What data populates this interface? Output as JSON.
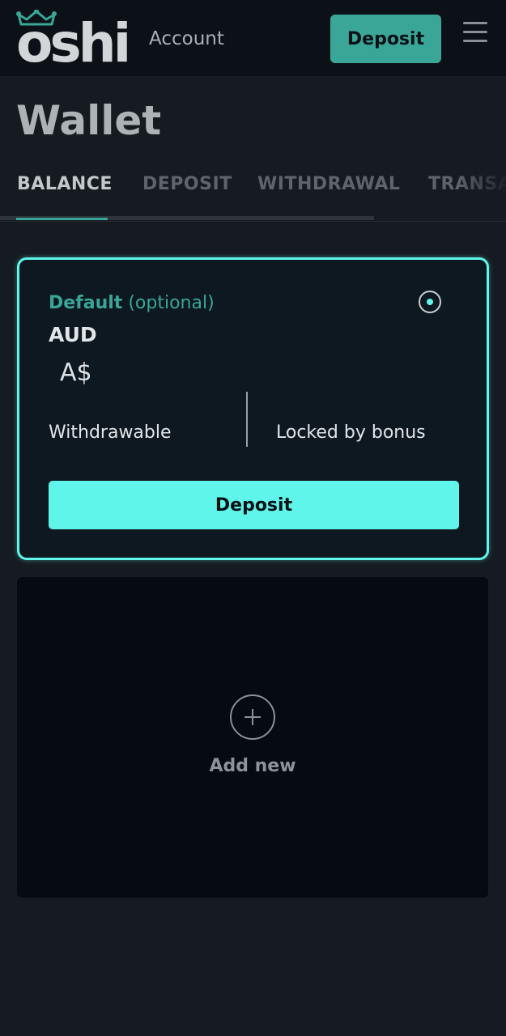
{
  "header": {
    "logo_text": "oshi",
    "account_label": "Account",
    "deposit_button": "Deposit"
  },
  "page": {
    "title": "Wallet"
  },
  "tabs": [
    {
      "label": "BALANCE",
      "active": true
    },
    {
      "label": "DEPOSIT",
      "active": false
    },
    {
      "label": "WITHDRAWAL",
      "active": false
    },
    {
      "label": "TRANSACTIONS",
      "active": false
    }
  ],
  "wallet": {
    "default_label": "Default",
    "optional_label": "(optional)",
    "currency": "AUD",
    "symbol": "A$",
    "withdrawable_label": "Withdrawable",
    "locked_label": "Locked by bonus",
    "deposit_button": "Deposit",
    "selected": true
  },
  "add_new": {
    "label": "Add new"
  },
  "colors": {
    "accent": "#5ff5ea",
    "accent_dark": "#3aa697",
    "background": "#161b22",
    "header_bg": "#0c1117"
  }
}
